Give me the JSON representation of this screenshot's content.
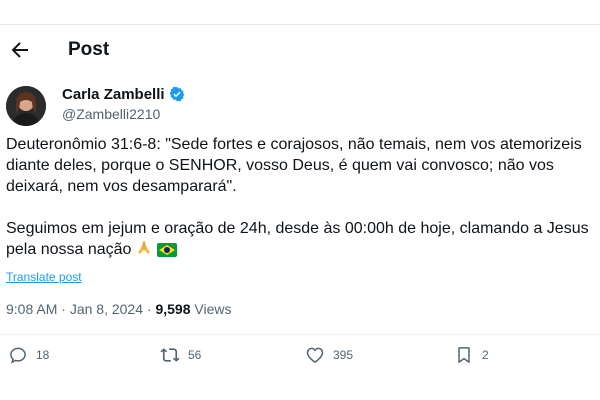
{
  "header": {
    "title": "Post"
  },
  "author": {
    "name": "Carla Zambelli",
    "handle": "@Zambelli2210",
    "verified": true
  },
  "post": {
    "paragraph1": "Deuteronômio 31:6-8: \"Sede fortes e corajosos, não temais, nem vos atemorizeis diante deles, porque o SENHOR, vosso Deus, é quem vai convosco; não vos deixará, nem vos desamparará\".",
    "paragraph2": "Seguimos em jejum e oração de 24h, desde às 00:00h de hoje, clamando a Jesus pela nossa nação",
    "translate_label": "Translate post"
  },
  "meta": {
    "time": "9:08 AM",
    "separator": "·",
    "date": "Jan 8, 2024",
    "views_count": "9,598",
    "views_label": "Views"
  },
  "actions": {
    "replies": "18",
    "reposts": "56",
    "likes": "395",
    "bookmarks": "2"
  },
  "colors": {
    "accent": "#1d9bf0",
    "secondary": "#536471",
    "text": "#0f1419"
  }
}
